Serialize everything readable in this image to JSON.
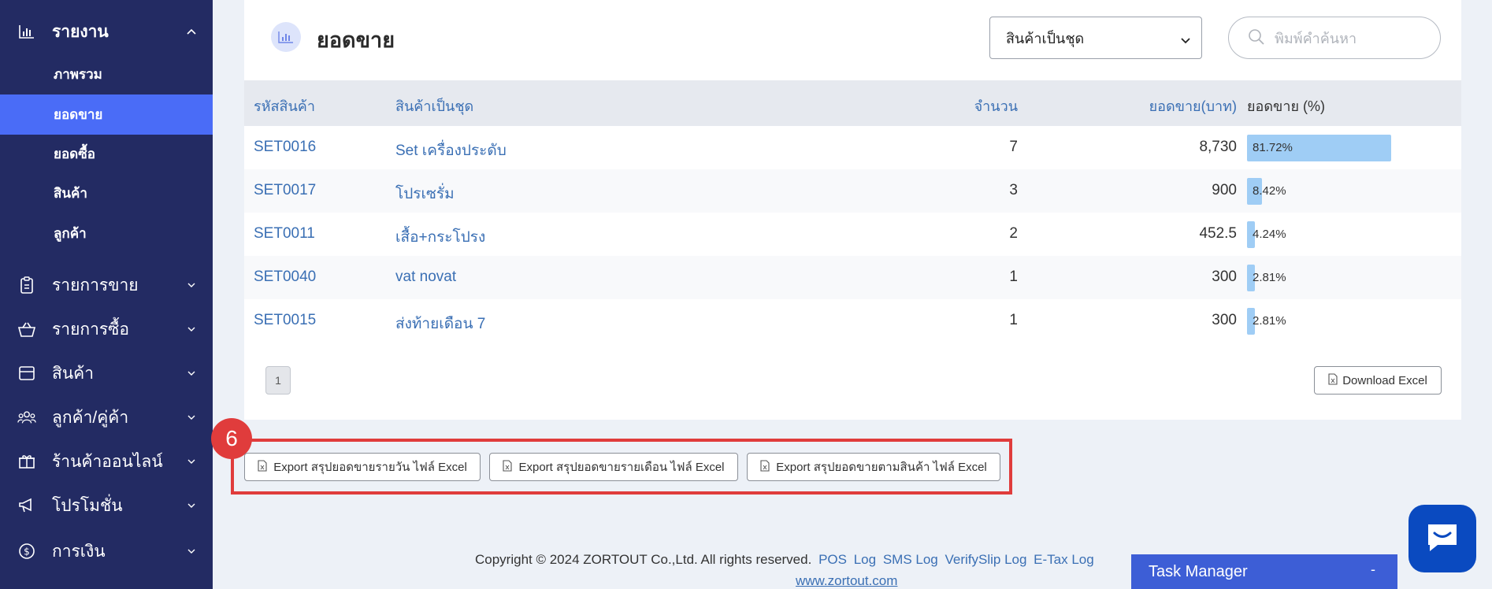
{
  "sidebar": {
    "top": {
      "label": "รายงาน",
      "icon": "chart-icon"
    },
    "subitems": [
      {
        "label": "ภาพรวม"
      },
      {
        "label": "ยอดขาย",
        "active": true
      },
      {
        "label": "ยอดซื้อ"
      },
      {
        "label": "สินค้า"
      },
      {
        "label": "ลูกค้า"
      }
    ],
    "items": [
      {
        "label": "รายการขาย",
        "icon": "clipboard-icon"
      },
      {
        "label": "รายการซื้อ",
        "icon": "basket-icon"
      },
      {
        "label": "สินค้า",
        "icon": "box-icon"
      },
      {
        "label": "ลูกค้า/คู่ค้า",
        "icon": "users-icon"
      },
      {
        "label": "ร้านค้าออนไลน์",
        "icon": "gift-icon"
      },
      {
        "label": "โปรโมชั่น",
        "icon": "megaphone-icon"
      },
      {
        "label": "การเงิน",
        "icon": "dollar-icon"
      }
    ]
  },
  "report": {
    "title": "ยอดขาย",
    "select_value": "สินค้าเป็นชุด",
    "search_placeholder": "พิมพ์คำค้นหา"
  },
  "table": {
    "headers": [
      "รหัสสินค้า",
      "สินค้าเป็นชุด",
      "จำนวน",
      "ยอดขาย(บาท)",
      "ยอดขาย (%)"
    ],
    "rows": [
      {
        "code": "SET0016",
        "name": "Set เครื่องประดับ",
        "qty": "7",
        "amount": "8,730",
        "pct": "81.72%",
        "pct_value": 81.72
      },
      {
        "code": "SET0017",
        "name": "โปรเซรั่ม",
        "qty": "3",
        "amount": "900",
        "pct": "8.42%",
        "pct_value": 8.42
      },
      {
        "code": "SET0011",
        "name": "เสื้อ+กระโปรง",
        "qty": "2",
        "amount": "452.5",
        "pct": "4.24%",
        "pct_value": 4.24
      },
      {
        "code": "SET0040",
        "name": "vat novat",
        "qty": "1",
        "amount": "300",
        "pct": "2.81%",
        "pct_value": 2.81
      },
      {
        "code": "SET0015",
        "name": "ส่งท้ายเดือน 7",
        "qty": "1",
        "amount": "300",
        "pct": "2.81%",
        "pct_value": 2.81
      }
    ],
    "page": "1",
    "download_label": "Download Excel"
  },
  "annotation": {
    "badge": "6",
    "color": "#e03c3c"
  },
  "exports": [
    {
      "label": "Export สรุปยอดขายรายวัน ไฟล์ Excel"
    },
    {
      "label": "Export สรุปยอดขายรายเดือน ไฟล์ Excel"
    },
    {
      "label": "Export สรุปยอดขายตามสินค้า ไฟล์ Excel"
    }
  ],
  "footer": {
    "copyright": "Copyright © 2024 ZORTOUT Co.,Ltd. All rights reserved.",
    "links": [
      "POS",
      "Log",
      "SMS Log",
      "VerifySlip Log",
      "E-Tax Log"
    ],
    "website": "www.zortout.com"
  },
  "task_manager": {
    "title": "Task Manager",
    "minimize": "-"
  },
  "colors": {
    "sidebar": "#232b63",
    "active": "#4a6cf7",
    "link": "#3a6fb4",
    "bar": "#9fcdf5"
  }
}
